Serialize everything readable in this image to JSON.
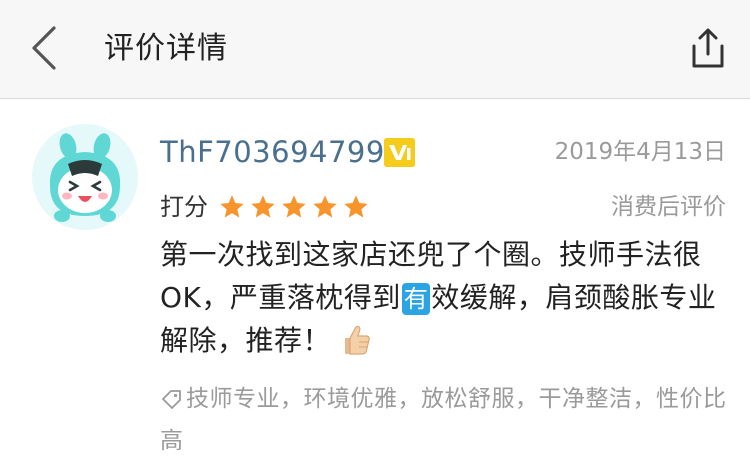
{
  "header": {
    "title": "评价详情"
  },
  "review": {
    "username": "ThF703694799",
    "level_badge": "V1",
    "date": "2019年4月13日",
    "score_label": "打分",
    "rating": 5,
    "rating_max": 5,
    "post_tag": "消费后评价",
    "text_part1": "第一次找到这家店还兜了个圈。技师手法很OK，严重落枕得到",
    "text_highlight": "有",
    "text_part2": "效缓解，肩颈酸胀专业解除，推荐！",
    "emoji": "thumbs-up",
    "tags": "技师专业，环境优雅，放松舒服，干净整洁，性价比高"
  },
  "colors": {
    "username": "#4b6f8e",
    "star": "#f7942b",
    "badge": "#f6cc1c",
    "highlight": "#2aa4e3",
    "muted": "#9a9a9a"
  }
}
